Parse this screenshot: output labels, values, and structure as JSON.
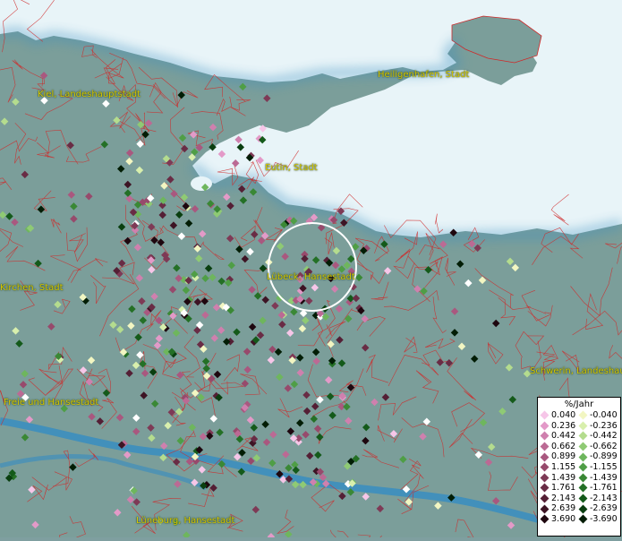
{
  "cities": [
    {
      "id": "kiel",
      "label": "Kiel, Landeshauptstadt"
    },
    {
      "id": "heiligenhafen",
      "label": "Heiligenhafen, Stadt"
    },
    {
      "id": "eutin",
      "label": "Eutin, Stadt"
    },
    {
      "id": "luebeck",
      "label": "Lübeck, Hansestadt"
    },
    {
      "id": "kirchen",
      "label": "Kirchen, Stadt"
    },
    {
      "id": "schwerin",
      "label": "Schwerin, Landeshau"
    },
    {
      "id": "bremen",
      "label": "Freie und Hansestadt"
    },
    {
      "id": "lueneburg",
      "label": "Lüneburg, Hansestadt"
    }
  ],
  "legend": {
    "title": "%/Jahr",
    "positive": [
      "0.040",
      "0.236",
      "0.442",
      "0.662",
      "0.899",
      "1.155",
      "1.439",
      "1.761",
      "2.143",
      "2.639",
      "3.690"
    ],
    "negative": [
      "-0.040",
      "-0.236",
      "-0.442",
      "-0.662",
      "-0.899",
      "-1.155",
      "-1.439",
      "-1.761",
      "-2.143",
      "-2.639",
      "-3.690"
    ],
    "positive_colors": [
      "#f6c6e8",
      "#e39ac8",
      "#cf80ae",
      "#bb6a94",
      "#a9587f",
      "#974a6c",
      "#7e3a56",
      "#692c45",
      "#541f35",
      "#3d1424",
      "#1e070f"
    ],
    "negative_colors": [
      "#f2f6c2",
      "#d8efad",
      "#b4dc8e",
      "#8fca74",
      "#6eb65d",
      "#4f9e46",
      "#3a8835",
      "#247026",
      "#145a1a",
      "#0a3f10",
      "#021d05"
    ]
  },
  "colors": {
    "sea": "#e8f4f8",
    "land": "#7b9e9a",
    "border": "#d02828",
    "label": "#d8c800"
  }
}
